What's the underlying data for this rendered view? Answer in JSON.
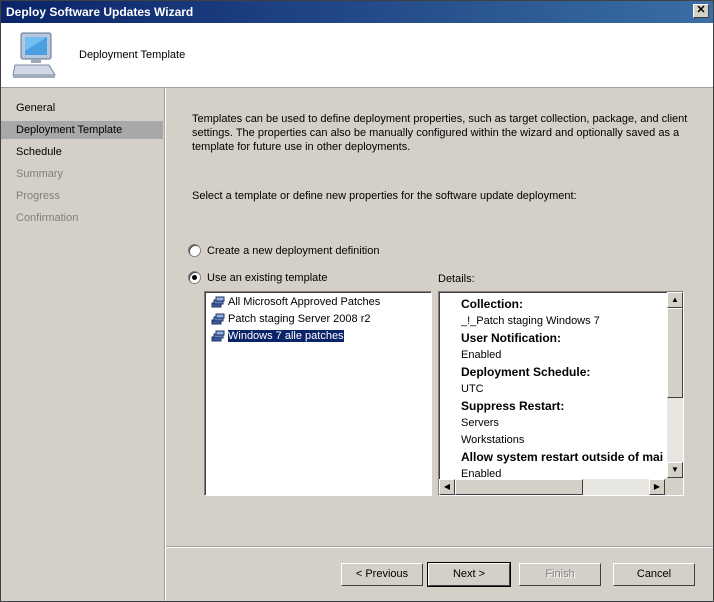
{
  "window": {
    "title": "Deploy Software Updates Wizard",
    "close_glyph": "✕"
  },
  "header": {
    "title": "Deployment Template"
  },
  "nav": {
    "items": [
      {
        "label": "General"
      },
      {
        "label": "Deployment Template"
      },
      {
        "label": "Schedule"
      },
      {
        "label": "Summary"
      },
      {
        "label": "Progress"
      },
      {
        "label": "Confirmation"
      }
    ]
  },
  "content": {
    "description": "Templates can be used to define deployment properties, such as target collection, package, and client settings. The properties can also be manually configured within the wizard and optionally saved as a template for future use in other deployments.",
    "prompt": "Select a template or define new properties for the software update deployment:",
    "radio_new": "Create a new deployment definition",
    "radio_existing": "Use an existing template",
    "selected_option": "Use an existing template",
    "details_label": "Details:",
    "templates": [
      {
        "label": "All Microsoft Approved Patches"
      },
      {
        "label": "Patch staging Server 2008 r2"
      },
      {
        "label": "Windows 7 alle patches"
      }
    ],
    "selected_template": "Windows 7 alle patches",
    "details": [
      {
        "text": "Collection:",
        "bold": true
      },
      {
        "text": "_!_Patch staging Windows 7",
        "bold": false
      },
      {
        "text": "User Notification:",
        "bold": true
      },
      {
        "text": "Enabled",
        "bold": false
      },
      {
        "text": "Deployment Schedule:",
        "bold": true
      },
      {
        "text": "UTC",
        "bold": false
      },
      {
        "text": "Suppress Restart:",
        "bold": true
      },
      {
        "text": "Servers",
        "bold": false
      },
      {
        "text": "Workstations",
        "bold": false
      },
      {
        "text": "Allow system restart outside of maint",
        "bold": true
      },
      {
        "text": "Enabled",
        "bold": false
      }
    ]
  },
  "footer": {
    "previous": "< Previous",
    "next": "Next >",
    "finish": "Finish",
    "cancel": "Cancel"
  },
  "colors": {
    "title_bar": "#0a246a",
    "selection": "#0a246a",
    "nav_active": "#a8a8a8"
  }
}
